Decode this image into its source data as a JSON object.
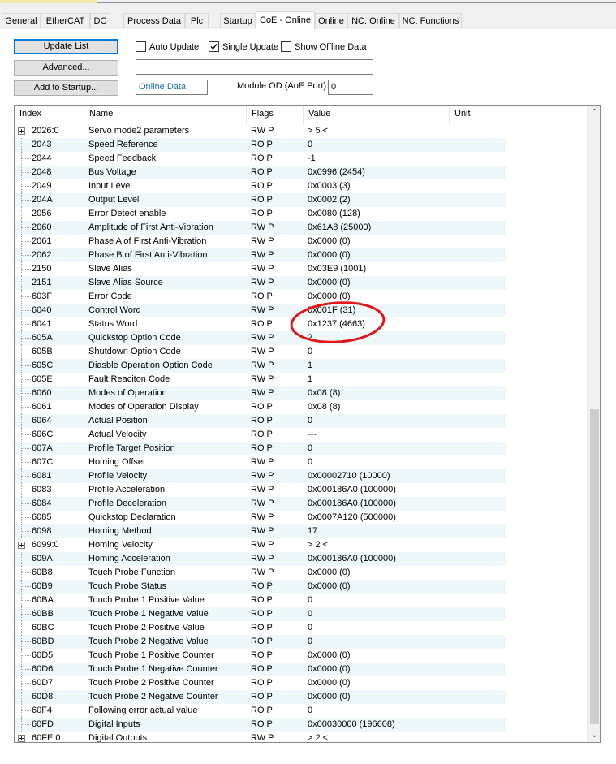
{
  "tabs": [
    "General",
    "EtherCAT",
    "DC",
    "Process Data",
    "Plc",
    "Startup",
    "CoE - Online",
    "Online",
    "NC: Online",
    "NC: Functions"
  ],
  "active_tab": "CoE - Online",
  "toolbar": {
    "update_list": "Update List",
    "advanced": "Advanced...",
    "add_to_startup": "Add to Startup...",
    "auto_update": "Auto Update",
    "single_update": "Single Update",
    "show_offline_data": "Show Offline Data",
    "online_data": "Online Data",
    "module_od_label": "Module OD (AoE Port):",
    "module_od_value": "0",
    "auto_update_checked": false,
    "single_update_checked": true,
    "show_offline_checked": false
  },
  "columns": [
    "Index",
    "Name",
    "Flags",
    "Value",
    "Unit"
  ],
  "rows": [
    {
      "index": "2026:0",
      "name": "Servo mode2 parameters",
      "flags": "RW P",
      "value": "> 5 <",
      "expandable": true
    },
    {
      "index": "2043",
      "name": "Speed Reference",
      "flags": "RO P",
      "value": "0"
    },
    {
      "index": "2044",
      "name": "Speed Feedback",
      "flags": "RO P",
      "value": "-1"
    },
    {
      "index": "2048",
      "name": "Bus Voltage",
      "flags": "RO P",
      "value": "0x0996 (2454)"
    },
    {
      "index": "2049",
      "name": "Input Level",
      "flags": "RO P",
      "value": "0x0003 (3)"
    },
    {
      "index": "204A",
      "name": "Output Level",
      "flags": "RO P",
      "value": "0x0002 (2)"
    },
    {
      "index": "2056",
      "name": "Error Detect enable",
      "flags": "RO P",
      "value": "0x0080 (128)"
    },
    {
      "index": "2060",
      "name": "Amplitude of First Anti-Vibration",
      "flags": "RW P",
      "value": "0x61A8 (25000)"
    },
    {
      "index": "2061",
      "name": "Phase A of First Anti-Vibration",
      "flags": "RW P",
      "value": "0x0000 (0)"
    },
    {
      "index": "2062",
      "name": "Phase B of First Anti-Vibration",
      "flags": "RW P",
      "value": "0x0000 (0)"
    },
    {
      "index": "2150",
      "name": "Slave Alias",
      "flags": "RW P",
      "value": "0x03E9 (1001)"
    },
    {
      "index": "2151",
      "name": "Slave Alias Source",
      "flags": "RW P",
      "value": "0x0000 (0)"
    },
    {
      "index": "603F",
      "name": "Error Code",
      "flags": "RO P",
      "value": "0x0000 (0)"
    },
    {
      "index": "6040",
      "name": "Control Word",
      "flags": "RW P",
      "value": "0x001F (31)"
    },
    {
      "index": "6041",
      "name": "Status Word",
      "flags": "RO P",
      "value": "0x1237 (4663)"
    },
    {
      "index": "605A",
      "name": "Quickstop Option Code",
      "flags": "RW P",
      "value": "2"
    },
    {
      "index": "605B",
      "name": "Shutdown Option Code",
      "flags": "RW P",
      "value": "0"
    },
    {
      "index": "605C",
      "name": "Diasble Operation Option Code",
      "flags": "RW P",
      "value": "1"
    },
    {
      "index": "605E",
      "name": "Fault Reaciton Code",
      "flags": "RW P",
      "value": "1"
    },
    {
      "index": "6060",
      "name": "Modes of Operation",
      "flags": "RW P",
      "value": "0x08 (8)"
    },
    {
      "index": "6061",
      "name": "Modes of Operation Display",
      "flags": "RO P",
      "value": "0x08 (8)"
    },
    {
      "index": "6064",
      "name": "Actual Position",
      "flags": "RO P",
      "value": "0"
    },
    {
      "index": "606C",
      "name": "Actual Velocity",
      "flags": "RO P",
      "value": "---"
    },
    {
      "index": "607A",
      "name": "Profile Target Position",
      "flags": "RO P",
      "value": "0"
    },
    {
      "index": "607C",
      "name": "Homing Offset",
      "flags": "RW P",
      "value": "0"
    },
    {
      "index": "6081",
      "name": "Profile Velocity",
      "flags": "RW P",
      "value": "0x00002710 (10000)"
    },
    {
      "index": "6083",
      "name": "Profile Acceleration",
      "flags": "RW P",
      "value": "0x000186A0 (100000)"
    },
    {
      "index": "6084",
      "name": "Profile Deceleration",
      "flags": "RW P",
      "value": "0x000186A0 (100000)"
    },
    {
      "index": "6085",
      "name": "Quickstop Declaration",
      "flags": "RW P",
      "value": "0x0007A120 (500000)"
    },
    {
      "index": "6098",
      "name": "Homing Method",
      "flags": "RW P",
      "value": "17"
    },
    {
      "index": "6099:0",
      "name": "Homing Velocity",
      "flags": "RW P",
      "value": "> 2 <",
      "expandable": true
    },
    {
      "index": "609A",
      "name": "Homing Acceleration",
      "flags": "RW P",
      "value": "0x000186A0 (100000)"
    },
    {
      "index": "60B8",
      "name": "Touch Probe Function",
      "flags": "RW P",
      "value": "0x0000 (0)"
    },
    {
      "index": "60B9",
      "name": "Touch Probe Status",
      "flags": "RO P",
      "value": "0x0000 (0)"
    },
    {
      "index": "60BA",
      "name": "Touch Probe 1 Positive Value",
      "flags": "RO P",
      "value": "0"
    },
    {
      "index": "60BB",
      "name": "Touch Probe 1 Negative Value",
      "flags": "RO P",
      "value": "0"
    },
    {
      "index": "60BC",
      "name": "Touch Probe 2 Positive Value",
      "flags": "RO P",
      "value": "0"
    },
    {
      "index": "60BD",
      "name": "Touch Probe 2 Negative Value",
      "flags": "RO P",
      "value": "0"
    },
    {
      "index": "60D5",
      "name": "Touch Probe 1 Positive Counter",
      "flags": "RO P",
      "value": "0x0000 (0)"
    },
    {
      "index": "60D6",
      "name": "Touch Probe 1 Negative Counter",
      "flags": "RO P",
      "value": "0x0000 (0)"
    },
    {
      "index": "60D7",
      "name": "Touch Probe 2 Positive Counter",
      "flags": "RO P",
      "value": "0x0000 (0)"
    },
    {
      "index": "60D8",
      "name": "Touch Probe 2 Negative Counter",
      "flags": "RO P",
      "value": "0x0000 (0)"
    },
    {
      "index": "60F4",
      "name": "Following error actual value",
      "flags": "RO P",
      "value": "0"
    },
    {
      "index": "60FD",
      "name": "Digital Inputs",
      "flags": "RO P",
      "value": "0x00030000 (196608)"
    },
    {
      "index": "60FE:0",
      "name": "Digital Outputs",
      "flags": "RW P",
      "value": "> 2 <",
      "expandable": true
    }
  ],
  "colors": {
    "row_tint": "#eef8fa",
    "annotation": "#e0161b",
    "online_data_text": "#1f6fb0",
    "default_button_border": "#0078d7"
  },
  "scrollbar": {
    "up_icon": "chevron-up-icon",
    "down_icon": "chevron-down-icon"
  }
}
